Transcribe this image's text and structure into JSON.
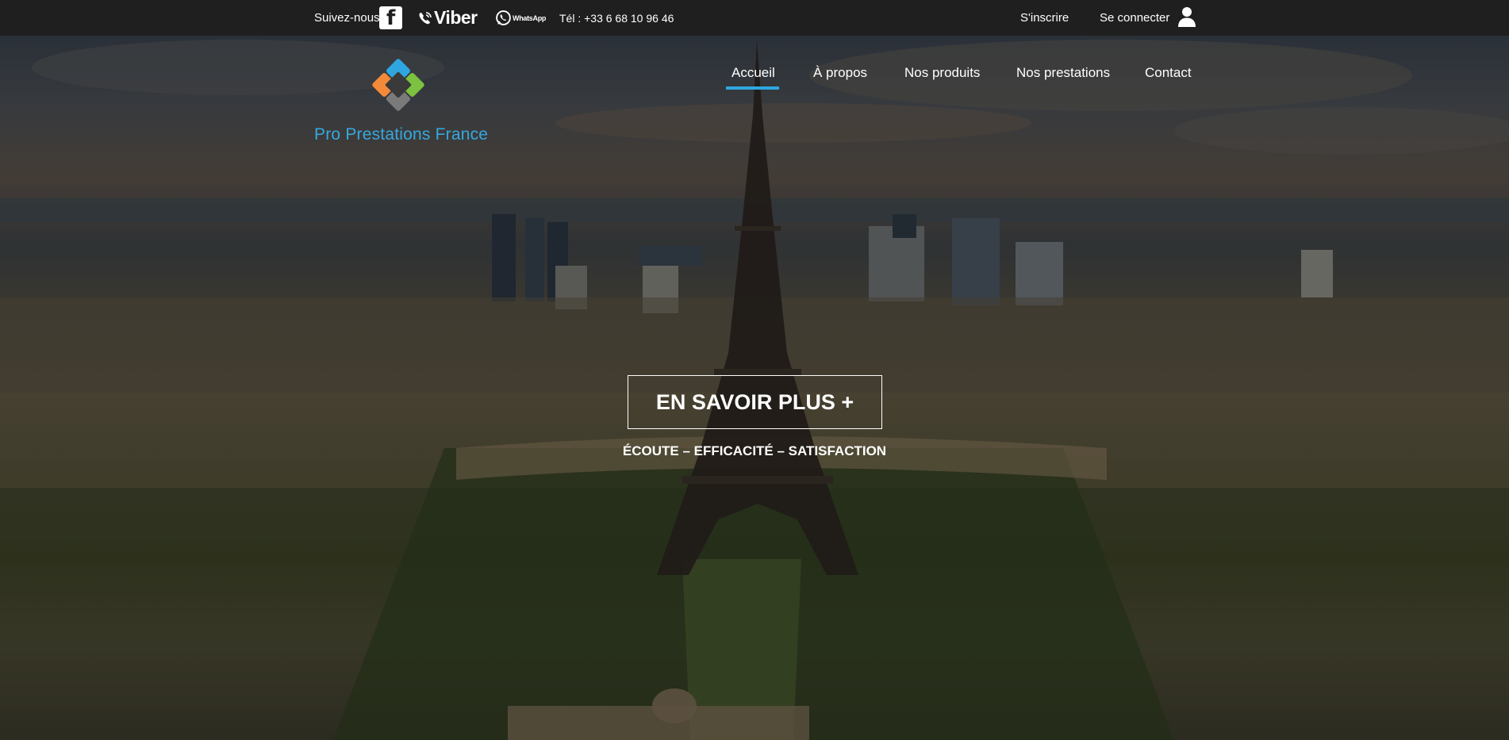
{
  "topbar": {
    "follow_label": "Suivez-nous",
    "facebook_glyph": "f",
    "viber_label": "Viber",
    "whatsapp_label": "WhatsApp",
    "phone": "Tél : +33 6 68 10 96 46",
    "signup_label": "S'inscrire",
    "login_label": "Se connecter",
    "icons": [
      "facebook-icon",
      "viber-icon",
      "whatsapp-icon",
      "user-icon"
    ]
  },
  "logo": {
    "name": "Pro Prestations France"
  },
  "nav": {
    "items": [
      {
        "label": "Accueil",
        "active": true
      },
      {
        "label": "À propos"
      },
      {
        "label": "Nos produits"
      },
      {
        "label": "Nos prestations"
      },
      {
        "label": "Contact"
      }
    ],
    "accent_color": "#2ea7e0"
  },
  "hero": {
    "cta_label": "EN SAVOIR PLUS +",
    "tagline": "ÉCOUTE – EFFICACITÉ – SATISFACTION"
  },
  "colors": {
    "topbar_bg": "#1f1f1f",
    "logo_text": "#35a8e0",
    "logo_tiles": [
      "#2ea7e0",
      "#f28a3a",
      "#7cc13f",
      "#7a7a7a"
    ]
  }
}
